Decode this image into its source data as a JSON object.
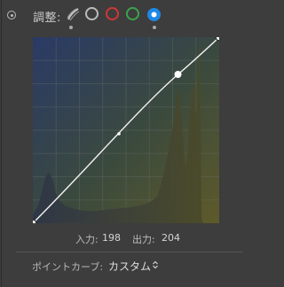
{
  "toolbar": {
    "label": "調整:",
    "channels": [
      {
        "name": "luminance",
        "icon": "feather-curve-icon",
        "color": "#c0c0c0"
      },
      {
        "name": "rgb",
        "icon": "rgb-channel-icon",
        "color": "#b8b8b8"
      },
      {
        "name": "red",
        "icon": "red-channel-icon",
        "color": "#d23a3a"
      },
      {
        "name": "green",
        "icon": "green-channel-icon",
        "color": "#3aa14a"
      },
      {
        "name": "blue",
        "icon": "blue-channel-icon",
        "color": "#1e88e5",
        "selected": true
      }
    ]
  },
  "curve": {
    "control_points": [
      [
        0,
        0
      ],
      [
        198,
        204
      ],
      [
        255,
        255
      ]
    ],
    "selected_point_index": 1,
    "grid_divisions": 8,
    "histogram_colors": [
      "#3b4a6a",
      "#6b6a3a"
    ]
  },
  "io": {
    "input_label": "入力:",
    "input_value": "198",
    "output_label": "出力:",
    "output_value": "204"
  },
  "preset": {
    "label": "ポイントカーブ:",
    "value": "カスタム"
  }
}
